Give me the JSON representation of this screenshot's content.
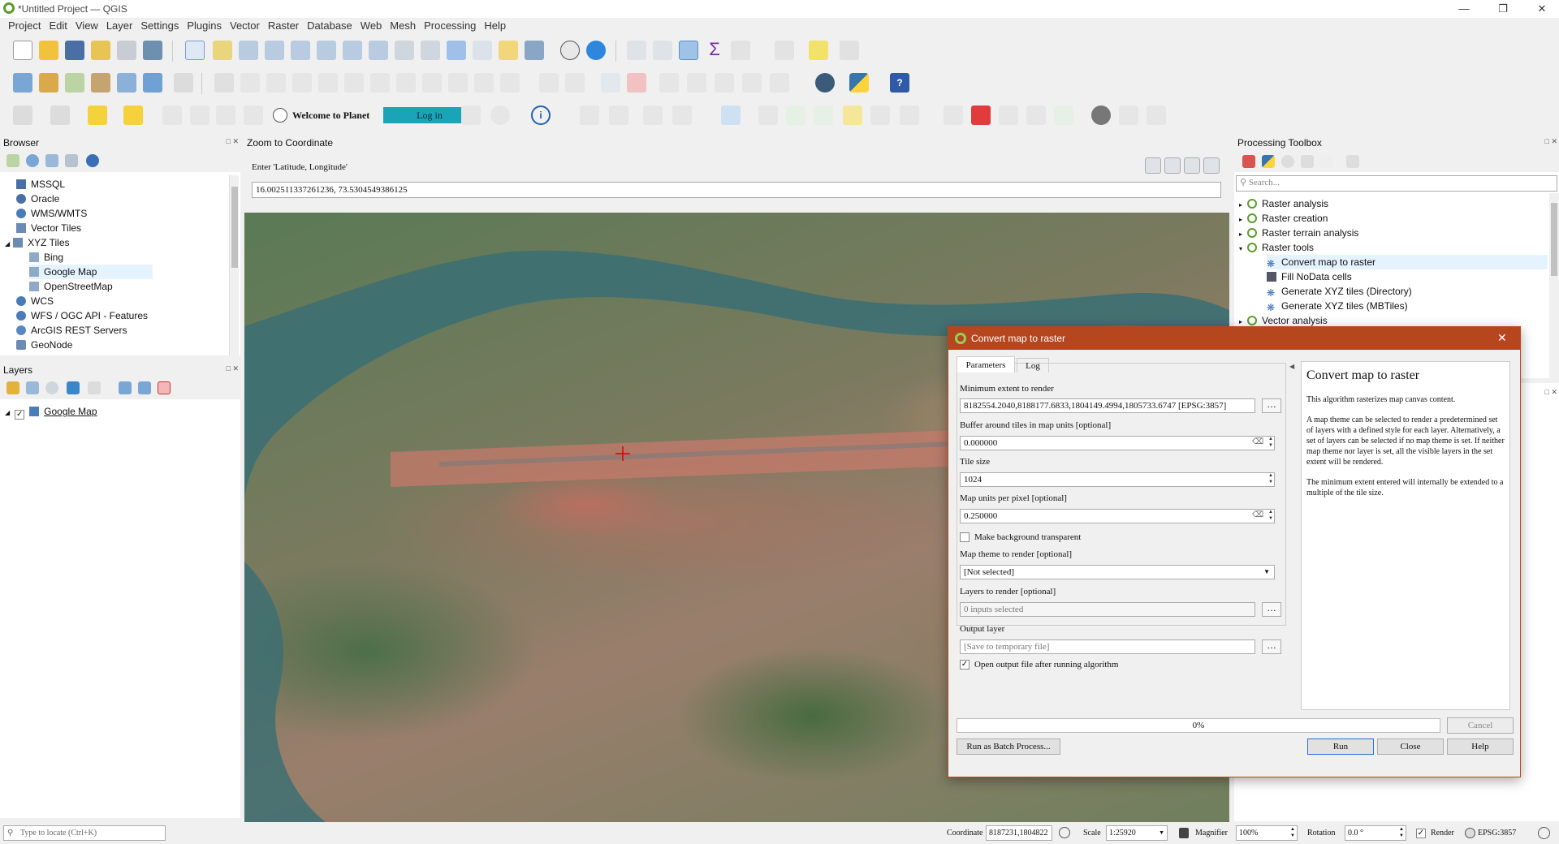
{
  "window": {
    "title": "*Untitled Project — QGIS"
  },
  "menu": [
    "Project",
    "Edit",
    "View",
    "Layer",
    "Settings",
    "Plugins",
    "Vector",
    "Raster",
    "Database",
    "Web",
    "Mesh",
    "Processing",
    "Help"
  ],
  "planet": {
    "welcome": "Welcome to Planet",
    "login": "Log in"
  },
  "browser": {
    "title": "Browser",
    "items": [
      {
        "label": "MSSQL",
        "icon": "mssql-icon"
      },
      {
        "label": "Oracle",
        "icon": "oracle-icon"
      },
      {
        "label": "WMS/WMTS",
        "icon": "wms-icon"
      },
      {
        "label": "Vector Tiles",
        "icon": "vector-tiles-icon"
      },
      {
        "label": "XYZ Tiles",
        "icon": "xyz-tiles-icon"
      },
      {
        "label": "Bing",
        "icon": "xyz-grid-icon"
      },
      {
        "label": "Google Map",
        "icon": "xyz-grid-icon"
      },
      {
        "label": "OpenStreetMap",
        "icon": "xyz-grid-icon"
      },
      {
        "label": "WCS",
        "icon": "wcs-icon"
      },
      {
        "label": "WFS / OGC API - Features",
        "icon": "wfs-icon"
      },
      {
        "label": "ArcGIS REST Servers",
        "icon": "arcgis-icon"
      },
      {
        "label": "GeoNode",
        "icon": "geonode-icon"
      }
    ]
  },
  "layers": {
    "title": "Layers",
    "items": [
      {
        "label": "Google Map",
        "checked": true
      }
    ]
  },
  "zoom": {
    "title": "Zoom to Coordinate",
    "prompt": "Enter 'Latitude, Longitude'",
    "value": "16.002511337261236, 73.5304549386125"
  },
  "toolbox": {
    "title": "Processing Toolbox",
    "search_placeholder": "Search...",
    "groups": [
      {
        "label": "Raster analysis"
      },
      {
        "label": "Raster creation"
      },
      {
        "label": "Raster terrain analysis"
      },
      {
        "label": "Raster tools"
      },
      {
        "label": "Vector analysis"
      }
    ],
    "tools": [
      {
        "label": "Convert map to raster"
      },
      {
        "label": "Fill NoData cells"
      },
      {
        "label": "Generate XYZ tiles (Directory)"
      },
      {
        "label": "Generate XYZ tiles (MBTiles)"
      }
    ]
  },
  "dialog": {
    "title": "Convert map to raster",
    "tabs": {
      "parameters": "Parameters",
      "log": "Log"
    },
    "min_extent_label": "Minimum extent to render",
    "min_extent_value": "8182554.2040,8188177.6833,1804149.4994,1805733.6747 [EPSG:3857]",
    "buffer_label": "Buffer around tiles in map units [optional]",
    "buffer_value": "0.000000",
    "tile_size_label": "Tile size",
    "tile_size_value": "1024",
    "mupp_label": "Map units per pixel [optional]",
    "mupp_value": "0.250000",
    "transparent_label": "Make background transparent",
    "map_theme_label": "Map theme to render [optional]",
    "map_theme_value": "[Not selected]",
    "layers_label": "Layers to render [optional]",
    "layers_value": "0 inputs selected",
    "output_label": "Output layer",
    "output_placeholder": "[Save to temporary file]",
    "open_output_label": "Open output file after running algorithm",
    "help_title": "Convert map to raster",
    "help_p1": "This algorithm rasterizes map canvas content.",
    "help_p2": "A map theme can be selected to render a predetermined set of layers with a defined style for each layer. Alternatively, a set of layers can be selected if no map theme is set. If neither map theme nor layer is set, all the visible layers in the set extent will be rendered.",
    "help_p3": "The minimum extent entered will internally be extended to a multiple of the tile size.",
    "progress": "0%",
    "progress_fraction": 0,
    "cancel": "Cancel",
    "batch": "Run as Batch Process...",
    "run": "Run",
    "close": "Close",
    "help": "Help"
  },
  "statusbar": {
    "locate_placeholder": "Type to locate (Ctrl+K)",
    "coordinate_label": "Coordinate",
    "coordinate_value": "8187231,1804822",
    "scale_label": "Scale",
    "scale_value": "1:25920",
    "magnifier_label": "Magnifier",
    "magnifier_value": "100%",
    "rotation_label": "Rotation",
    "rotation_value": "0.0 °",
    "render_label": "Render",
    "crs": "EPSG:3857"
  },
  "colors": {
    "dialog_titlebar": "#b6461d",
    "qgis_green": "#5b9d2a",
    "selection": "#e5f3ff",
    "planet_login": "#1ba3b8"
  }
}
